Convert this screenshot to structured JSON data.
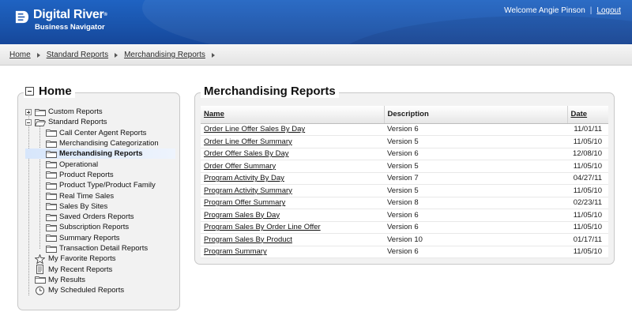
{
  "brand": {
    "name": "Digital River",
    "trademark": "®",
    "product": "Business Navigator"
  },
  "user": {
    "welcome": "Welcome Angie Pinson",
    "separator": "|",
    "logout_label": "Logout"
  },
  "breadcrumb": [
    "Home",
    "Standard Reports",
    "Merchandising Reports"
  ],
  "left_panel": {
    "title": "Home",
    "tree": [
      {
        "label": "Custom Reports",
        "icon": "folder-icon",
        "expander": "plus"
      },
      {
        "label": "Standard Reports",
        "icon": "folder-open-icon",
        "expander": "minus"
      },
      {
        "label": "Call Center Agent Reports",
        "icon": "folder-icon",
        "child": true
      },
      {
        "label": "Merchandising Categorization",
        "icon": "folder-icon",
        "child": true
      },
      {
        "label": "Merchandising Reports",
        "icon": "folder-icon",
        "child": true,
        "selected": true
      },
      {
        "label": "Operational",
        "icon": "folder-icon",
        "child": true
      },
      {
        "label": "Product Reports",
        "icon": "folder-icon",
        "child": true
      },
      {
        "label": "Product Type/Product Family",
        "icon": "folder-icon",
        "child": true
      },
      {
        "label": "Real Time Sales",
        "icon": "folder-icon",
        "child": true
      },
      {
        "label": "Sales By Sites",
        "icon": "folder-icon",
        "child": true
      },
      {
        "label": "Saved Orders Reports",
        "icon": "folder-icon",
        "child": true
      },
      {
        "label": "Subscription Reports",
        "icon": "folder-icon",
        "child": true
      },
      {
        "label": "Summary Reports",
        "icon": "folder-icon",
        "child": true
      },
      {
        "label": "Transaction Detail Reports",
        "icon": "folder-icon",
        "child": true
      },
      {
        "label": "My Favorite Reports",
        "icon": "star-icon"
      },
      {
        "label": "My Recent Reports",
        "icon": "document-icon"
      },
      {
        "label": "My Results",
        "icon": "folder-icon"
      },
      {
        "label": "My Scheduled Reports",
        "icon": "clock-icon"
      }
    ]
  },
  "main": {
    "title": "Merchandising Reports",
    "columns": [
      "Name",
      "Description",
      "Date"
    ],
    "rows": [
      {
        "name": "Order Line Offer Sales By Day",
        "description": "Version 6",
        "date": "11/01/11"
      },
      {
        "name": "Order Line Offer Summary",
        "description": "Version 5",
        "date": "11/05/10"
      },
      {
        "name": "Order Offer Sales By Day",
        "description": "Version 6",
        "date": "12/08/10"
      },
      {
        "name": "Order Offer Summary",
        "description": "Version 5",
        "date": "11/05/10"
      },
      {
        "name": "Program Activity By Day",
        "description": "Version 7",
        "date": "04/27/11"
      },
      {
        "name": "Program Activity Summary",
        "description": "Version 5",
        "date": "11/05/10"
      },
      {
        "name": "Program Offer Summary",
        "description": "Version 8",
        "date": "02/23/11"
      },
      {
        "name": "Program Sales By Day",
        "description": "Version 6",
        "date": "11/05/10"
      },
      {
        "name": "Program Sales By Order Line Offer",
        "description": "Version 6",
        "date": "11/05/10"
      },
      {
        "name": "Program Sales By Product",
        "description": "Version 10",
        "date": "01/17/11"
      },
      {
        "name": "Program Summary",
        "description": "Version 6",
        "date": "11/05/10"
      }
    ]
  },
  "colors": {
    "header_blue": "#1a55ad",
    "panel_bg": "#f2f2f2",
    "selected_bg": "#d7e6fb"
  }
}
